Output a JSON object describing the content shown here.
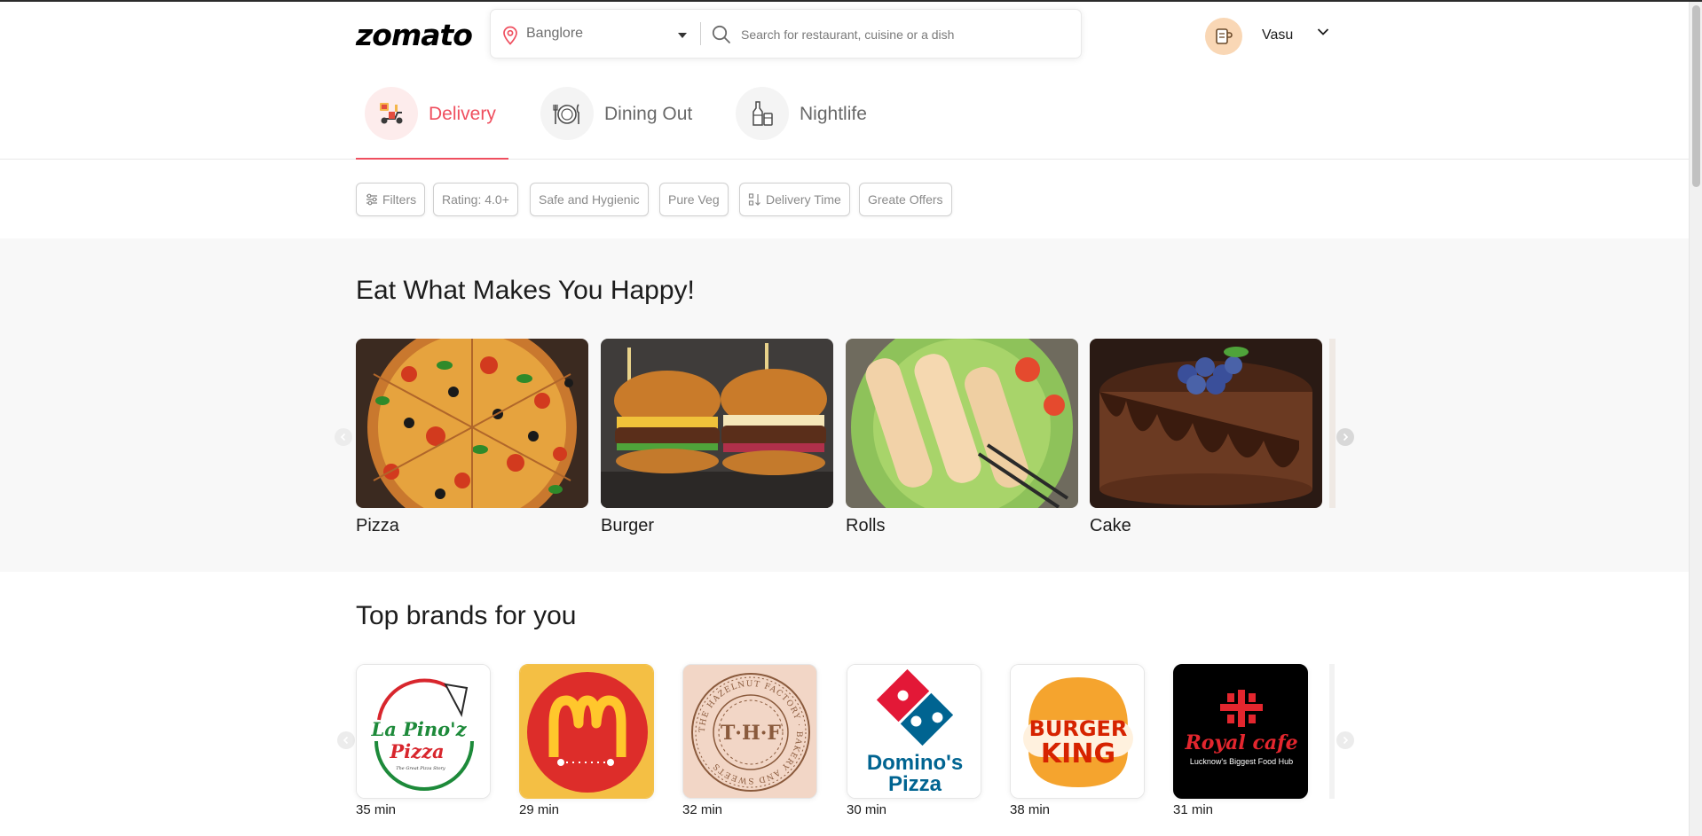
{
  "header": {
    "logo": "zomato",
    "location": "Banglore",
    "search_placeholder": "Search for restaurant, cuisine or a dish",
    "username": "Vasu"
  },
  "tabs": [
    {
      "label": "Delivery",
      "icon": "scooter-icon",
      "active": true
    },
    {
      "label": "Dining Out",
      "icon": "dining-plate-icon",
      "active": false
    },
    {
      "label": "Nightlife",
      "icon": "drinks-bottle-icon",
      "active": false
    }
  ],
  "filters": [
    {
      "label": "Filters",
      "icon": "sliders-icon"
    },
    {
      "label": "Rating: 4.0+"
    },
    {
      "label": "Safe and Hygienic"
    },
    {
      "label": "Pure Veg"
    },
    {
      "label": "Delivery Time",
      "icon": "sort-icon"
    },
    {
      "label": "Greate Offers"
    }
  ],
  "eat_section": {
    "title": "Eat What Makes You Happy!",
    "items": [
      {
        "label": "Pizza"
      },
      {
        "label": "Burger"
      },
      {
        "label": "Rolls"
      },
      {
        "label": "Cake"
      }
    ]
  },
  "brands_section": {
    "title": "Top brands for you",
    "items": [
      {
        "name": "La Pino'z Pizza",
        "logo_text": "La Pino'z",
        "logo_sub": "Pizza",
        "tagline": "The Great Pizza Story",
        "time": "35 min"
      },
      {
        "name": "McDonald's",
        "time": "29 min"
      },
      {
        "name": "The Hazelnut Factory",
        "logo_text": "T·H·F",
        "ring_text": "THE HAZELNUT FACTORY · BAKERY AND SWEETS",
        "time": "32 min"
      },
      {
        "name": "Domino's Pizza",
        "logo_text": "Domino's",
        "logo_sub": "Pizza",
        "time": "30 min"
      },
      {
        "name": "Burger King",
        "logo_text": "BURGER",
        "logo_sub": "KING",
        "time": "38 min"
      },
      {
        "name": "Royal Cafe",
        "logo_text": "Royal cafe",
        "tagline": "Lucknow's Biggest Food Hub",
        "time": "31 min"
      }
    ]
  },
  "colors": {
    "accent": "#ef4f5f",
    "section_bg": "#f8f8f8"
  }
}
